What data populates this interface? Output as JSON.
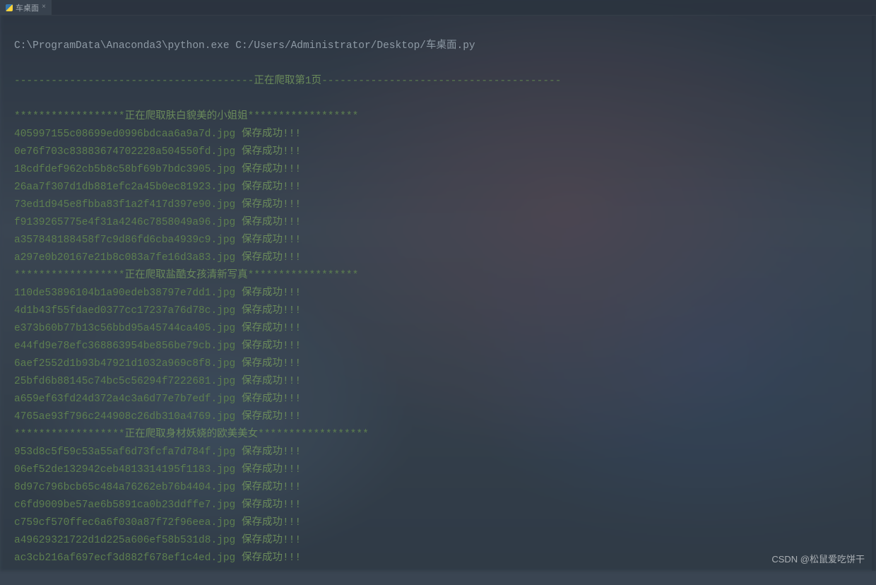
{
  "tab": {
    "title": "车桌面",
    "close": "×"
  },
  "cmd": "C:\\ProgramData\\Anaconda3\\python.exe C:/Users/Administrator/Desktop/车桌面.py",
  "pageHeader": {
    "prefix": "---------------------------------------",
    "text": "正在爬取第1页",
    "suffix": "---------------------------------------"
  },
  "sections": [
    {
      "title": "正在爬取肤白貌美的小姐姐",
      "stars": "******************",
      "files": [
        "405997155c08699ed0996bdcaa6a9a7d.jpg",
        "0e76f703c83883674702228a504550fd.jpg",
        "18cdfdef962cb5b8c58bf69b7bdc3905.jpg",
        "26aa7f307d1db881efc2a45b0ec81923.jpg",
        "73ed1d945e8fbba83f1a2f417d397e90.jpg",
        "f9139265775e4f31a4246c7858049a96.jpg",
        "a357848188458f7c9d86fd6cba4939c9.jpg",
        "a297e0b20167e21b8c083a7fe16d3a83.jpg"
      ]
    },
    {
      "title": "正在爬取盐酷女孩清新写真",
      "stars": "******************",
      "files": [
        "110de53896104b1a90edeb38797e7dd1.jpg",
        "4d1b43f55fdaed0377cc17237a76d78c.jpg",
        "e373b60b77b13c56bbd95a45744ca405.jpg",
        "e44fd9e78efc368863954be856be79cb.jpg",
        "6aef2552d1b93b47921d1032a969c8f8.jpg",
        "25bfd6b88145c74bc5c56294f7222681.jpg",
        "a659ef63fd24d372a4c3a6d77e7b7edf.jpg",
        "4765ae93f796c244908c26db310a4769.jpg"
      ]
    },
    {
      "title": "正在爬取身材妖娆的欧美美女",
      "stars": "******************",
      "files": [
        "953d8c5f59c53a55af6d73fcfa7d784f.jpg",
        "06ef52de132942ceb4813314195f1183.jpg",
        "8d97c796bcb65c484a76262eb76b4404.jpg",
        "c6fd9009be57ae6b5891ca0b23ddffe7.jpg",
        "c759cf570ffec6a6f030a87f72f96eea.jpg",
        "a49629321722d1d225a606ef58b531d8.jpg",
        "ac3cb216af697ecf3d882f678ef1c4ed.jpg"
      ]
    }
  ],
  "saveSuccess": "保存成功!!!",
  "watermark": "CSDN @松鼠爱吃饼干"
}
